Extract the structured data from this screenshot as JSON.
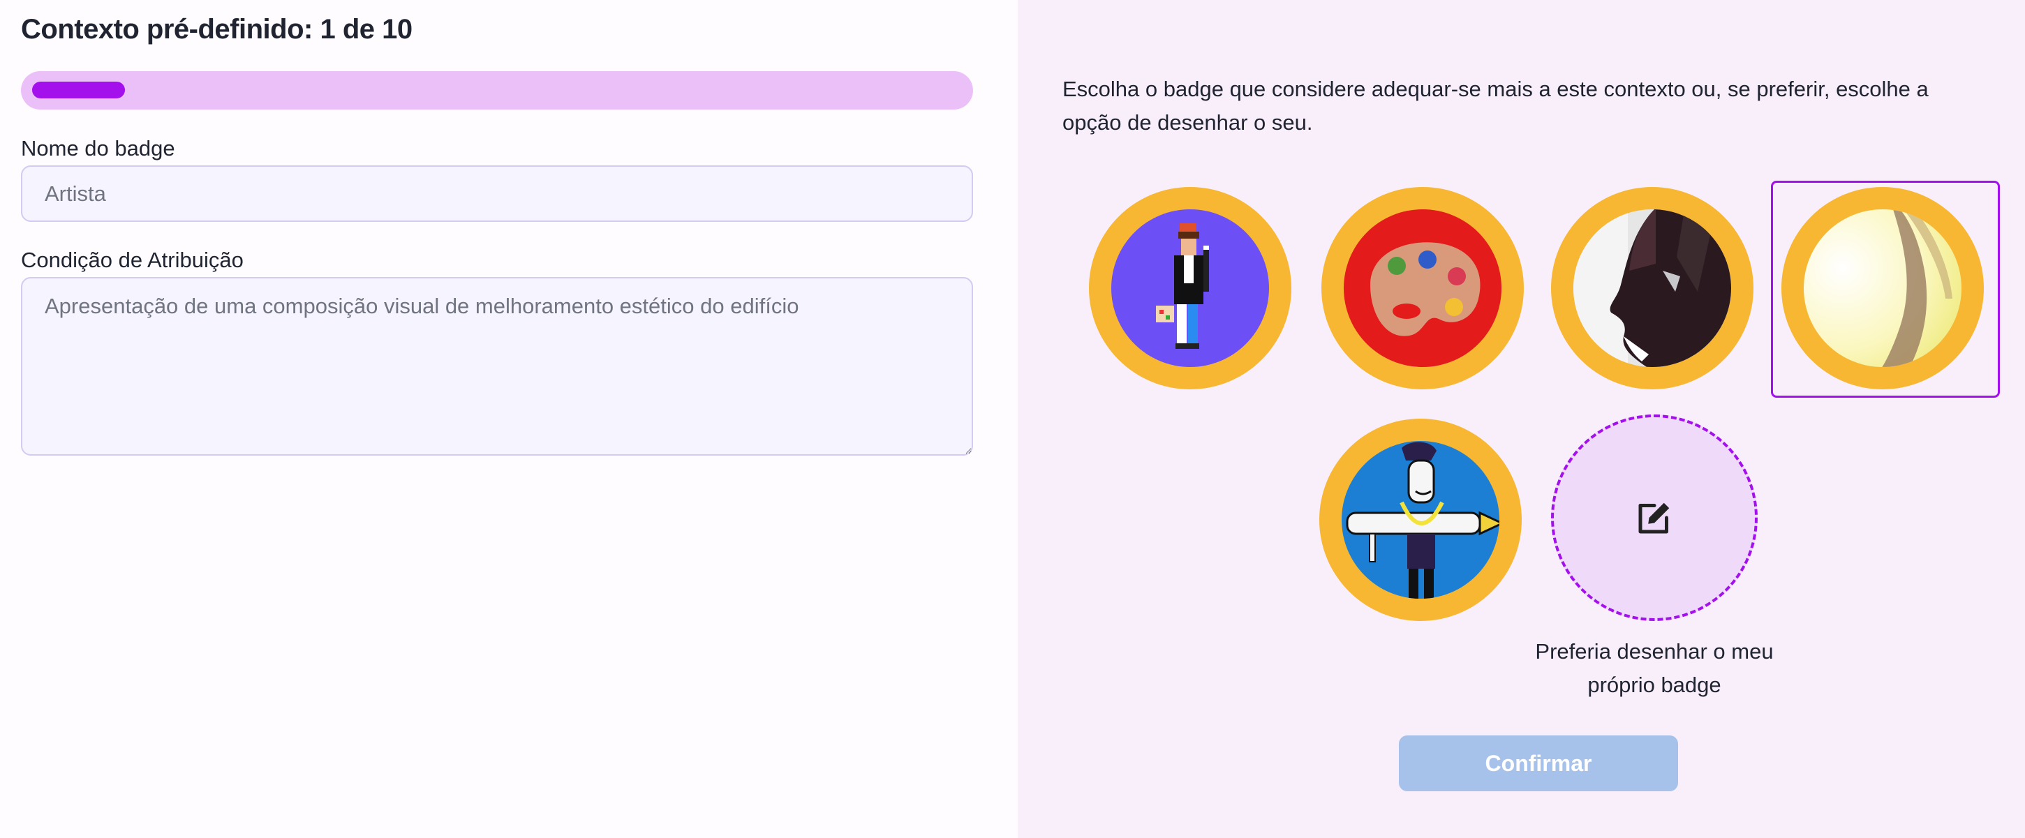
{
  "header": {
    "title": "Contexto pré-definido: 1 de 10"
  },
  "progress": {
    "current": 1,
    "total": 10,
    "fraction": 0.1,
    "fill_color": "#a310ec",
    "track_color": "#ebc0f8"
  },
  "form": {
    "name_label": "Nome do badge",
    "name_placeholder": "Artista",
    "condition_label": "Condição de Atribuição",
    "condition_placeholder": "Apresentação de uma composição visual de melhoramento estético do edifício"
  },
  "badges": {
    "description": "Escolha o badge que considere adequar-se mais a este contexto ou, se preferir, escolhe a opção de desenhar o seu.",
    "options": [
      {
        "image": "pixel-artist-image",
        "selected": false
      },
      {
        "image": "paint-palette-image",
        "selected": false
      },
      {
        "image": "abstract-face-image",
        "selected": false
      },
      {
        "image": "yellow-abstract-image",
        "selected": true
      },
      {
        "image": "cartoon-pencil-man-image",
        "selected": false
      }
    ],
    "draw_own_label": "Preferia desenhar o meu próprio badge",
    "draw_icon": "edit-icon",
    "ring_color": "#f7b733"
  },
  "actions": {
    "confirm_label": "Confirmar"
  }
}
